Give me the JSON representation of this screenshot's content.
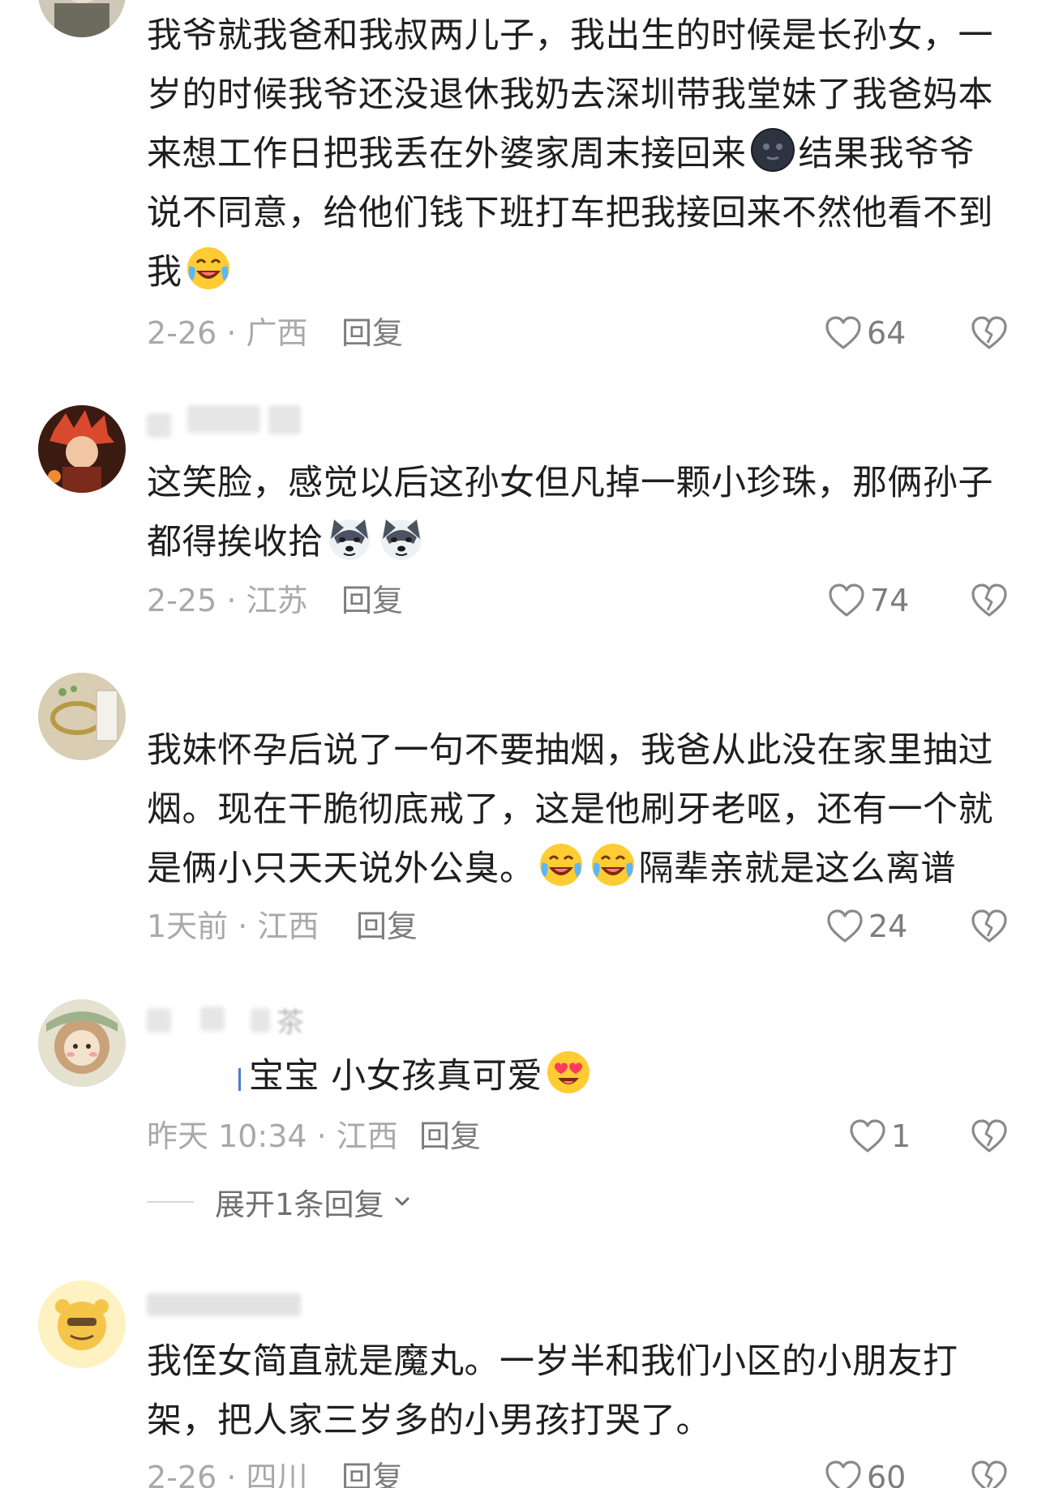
{
  "comments": [
    {
      "text_lines": [
        "我爷就我爸和我叔两儿子，我出生的时候是长孙女，一",
        "岁的时候我爷还没退休我奶去深圳带我堂妹了我爸妈本",
        "来想工作日把我丢在外婆家周末接回来",
        "结果我爷爷",
        "说不同意，给他们钱下班打车把我接回来不然他看不到",
        "我"
      ],
      "time_location": "2-26 · 广西",
      "reply_label": "回复",
      "likes": "64",
      "emojis": [
        "dark-moon-emoji",
        "laughing-crying-emoji"
      ]
    },
    {
      "text_lines": [
        "这笑脸，感觉以后这孙女但凡掉一颗小珍珠，那俩孙子",
        "都得挨收拾"
      ],
      "time_location": "2-25 · 江苏",
      "reply_label": "回复",
      "likes": "74",
      "emojis": [
        "husky-dog-emoji",
        "husky-dog-emoji"
      ]
    },
    {
      "text_lines": [
        "我妹怀孕后说了一句不要抽烟，我爸从此没在家里抽过",
        "烟。现在干脆彻底戒了，这是他刷牙老呕，还有一个就",
        "是俩小只天天说外公臭。",
        "隔辈亲就是这么离谱"
      ],
      "time_location": "1天前 · 江西",
      "reply_label": "回复",
      "likes": "24",
      "emojis": [
        "laughing-crying-emoji",
        "laughing-crying-emoji"
      ]
    },
    {
      "username": "茶",
      "text_lines": [
        "宝宝 小女孩真可爱"
      ],
      "time_location": "昨天 10:34 · 江西",
      "reply_label": "回复",
      "likes": "1",
      "emojis": [
        "heart-eyes-emoji"
      ],
      "expand_label": "展开1条回复"
    },
    {
      "text_lines": [
        "我侄女简直就是魔丸。一岁半和我们小区的小朋友打",
        "架，把人家三岁多的小男孩打哭了。"
      ],
      "time_location": "2-26 · 四川",
      "reply_label": "回复",
      "likes": "60"
    }
  ],
  "colors": {
    "text": "#1f1f1f",
    "meta": "#a9a9a9",
    "action": "#7d7d7d"
  }
}
